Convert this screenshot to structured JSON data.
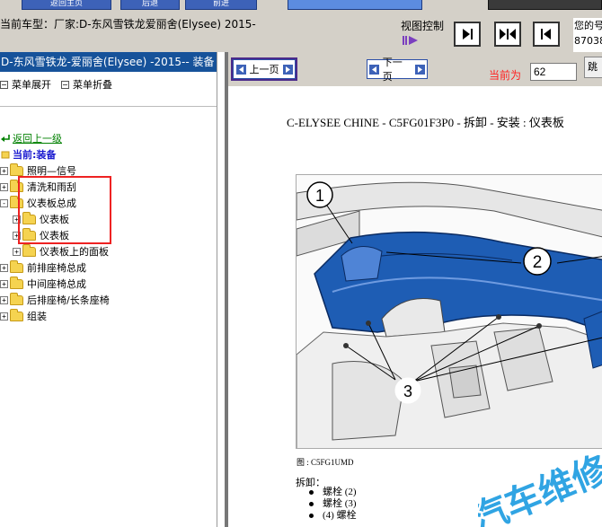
{
  "header": {
    "top_buttons": [
      "返回主页",
      "后退",
      "前进",
      "",
      ""
    ],
    "car_model": "当前车型：厂家:D-东风雪铁龙爱丽舍(Elysee)   2015-",
    "view_control_label": "视图控制",
    "user_info_line1": "您的号",
    "user_info_line2": "87038"
  },
  "left_panel": {
    "title": "D-东风雪铁龙-爱丽舍(Elysee)   -2015-- 装备",
    "menu_expand": "菜单展开",
    "menu_collapse": "菜单折叠",
    "back_link": "返回上一级",
    "current_label": "当前:装备",
    "tree": [
      {
        "label": "照明—信号",
        "toggle": "+"
      },
      {
        "label": "清洗和雨刮",
        "toggle": "+"
      },
      {
        "label": "仪表板总成",
        "toggle": "-"
      },
      {
        "label": "仪表板",
        "toggle": "+"
      },
      {
        "label": "仪表板",
        "toggle": "+"
      },
      {
        "label": "仪表板上的面板",
        "toggle": "+"
      },
      {
        "label": "前排座椅总成",
        "toggle": "+"
      },
      {
        "label": "中间座椅总成",
        "toggle": "+"
      },
      {
        "label": "后排座椅/长条座椅",
        "toggle": "+"
      },
      {
        "label": "组装",
        "toggle": "+"
      }
    ]
  },
  "nav": {
    "prev_page": "上一页",
    "next_page": "下一页",
    "current_page_label": "当前为",
    "current_page_value": "62",
    "jump_label": "跳转"
  },
  "document": {
    "title": "C-ELYSEE CHINE - C5FG01F3P0 - 拆卸 - 安装 : 仪表板",
    "callouts": [
      "1",
      "2",
      "3"
    ],
    "figure_caption": "图 : C5FG1UMD",
    "removal_title": "拆卸：",
    "removal_items": [
      "螺栓 (2)",
      "螺栓 (3)",
      "(4) 螺栓"
    ],
    "watermark_text": "汽车维修"
  },
  "colors": {
    "left_title_bg": "#16529a",
    "dashboard_blue": "#1e5db4",
    "highlight_red": "#ee2222",
    "current_page_red": "#ff1f1f",
    "back_link_green": "#008000"
  },
  "icons": [
    "folder-icon",
    "arrow-left-icon",
    "arrow-right-icon",
    "view-next-icon",
    "view-fit-icon",
    "view-prev-icon",
    "back-arrow-icon"
  ]
}
